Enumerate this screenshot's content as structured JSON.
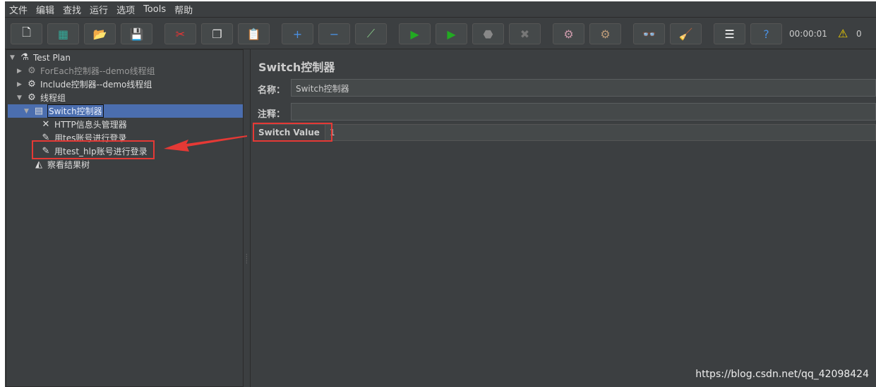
{
  "menu": [
    "文件",
    "编辑",
    "查找",
    "运行",
    "选项",
    "Tools",
    "帮助"
  ],
  "toolbar": [
    {
      "icon": "new-icon",
      "g": "🗋",
      "c": "#fff"
    },
    {
      "icon": "templates-icon",
      "g": "▦",
      "c": "#3a9"
    },
    {
      "icon": "open-icon",
      "g": "📂",
      "c": "#e0a030"
    },
    {
      "icon": "save-icon",
      "g": "💾",
      "c": "#ccc"
    },
    {
      "icon": "cut-icon",
      "g": "✂",
      "c": "#e33"
    },
    {
      "icon": "copy-icon",
      "g": "❐",
      "c": "#ddd"
    },
    {
      "icon": "paste-icon",
      "g": "📋",
      "c": "#d8a050"
    },
    {
      "icon": "expand-icon",
      "g": "+",
      "c": "#4a90e2"
    },
    {
      "icon": "collapse-icon",
      "g": "−",
      "c": "#4a90e2"
    },
    {
      "icon": "toggle-icon",
      "g": "⟋",
      "c": "#8c8"
    },
    {
      "icon": "start-icon",
      "g": "▶",
      "c": "#2a2"
    },
    {
      "icon": "start-no-pauses-icon",
      "g": "▶",
      "c": "#2a2"
    },
    {
      "icon": "stop-icon",
      "g": "⬣",
      "c": "#888"
    },
    {
      "icon": "shutdown-icon",
      "g": "✖",
      "c": "#777"
    },
    {
      "icon": "clear-icon",
      "g": "⚙",
      "c": "#c9a"
    },
    {
      "icon": "clear-all-icon",
      "g": "⚙",
      "c": "#b97"
    },
    {
      "icon": "search-icon",
      "g": "👓",
      "c": "#ddd"
    },
    {
      "icon": "reset-search-icon",
      "g": "🧹",
      "c": "#fd0"
    },
    {
      "icon": "function-helper-icon",
      "g": "☰",
      "c": "#fff"
    },
    {
      "icon": "help-icon",
      "g": "?",
      "c": "#4a90e2"
    }
  ],
  "status": {
    "timer": "00:00:01",
    "warnings": "0"
  },
  "tree": [
    {
      "label": "Test Plan",
      "icon": "test-plan-icon",
      "g": "⚗",
      "indent": 0,
      "tw": "▼"
    },
    {
      "label": "ForEach控制器--demo线程组",
      "icon": "thread-group-icon",
      "g": "⚙",
      "indent": 1,
      "tw": "▶",
      "dim": true
    },
    {
      "label": "Include控制器--demo线程组",
      "icon": "thread-group-icon",
      "g": "⚙",
      "indent": 1,
      "tw": "▶"
    },
    {
      "label": "线程组",
      "icon": "thread-group-icon",
      "g": "⚙",
      "indent": 1,
      "tw": "▼"
    },
    {
      "label": "Switch控制器",
      "icon": "switch-controller-icon",
      "g": "▤",
      "indent": 2,
      "tw": "▼",
      "selected": true
    },
    {
      "label": "HTTP信息头管理器",
      "icon": "header-manager-icon",
      "g": "✕",
      "indent": 3,
      "tw": ""
    },
    {
      "label": "用tes账号进行登录",
      "icon": "sampler-icon",
      "g": "✎",
      "indent": 3,
      "tw": ""
    },
    {
      "label": "用test_hlp账号进行登录",
      "icon": "sampler-icon",
      "g": "✎",
      "indent": 3,
      "tw": ""
    },
    {
      "label": "察看结果树",
      "icon": "result-tree-icon",
      "g": "◭",
      "indent": 2,
      "tw": ""
    }
  ],
  "main": {
    "title": "Switch控制器",
    "name_label": "名称：",
    "name_value": "Switch控制器",
    "comment_label": "注释：",
    "comment_value": "",
    "switch_label": "Switch Value",
    "switch_value": "1"
  },
  "watermark": "https://blog.csdn.net/qq_42098424",
  "colors": {
    "highlight": "#e53935",
    "selection": "#4b6eaf"
  }
}
